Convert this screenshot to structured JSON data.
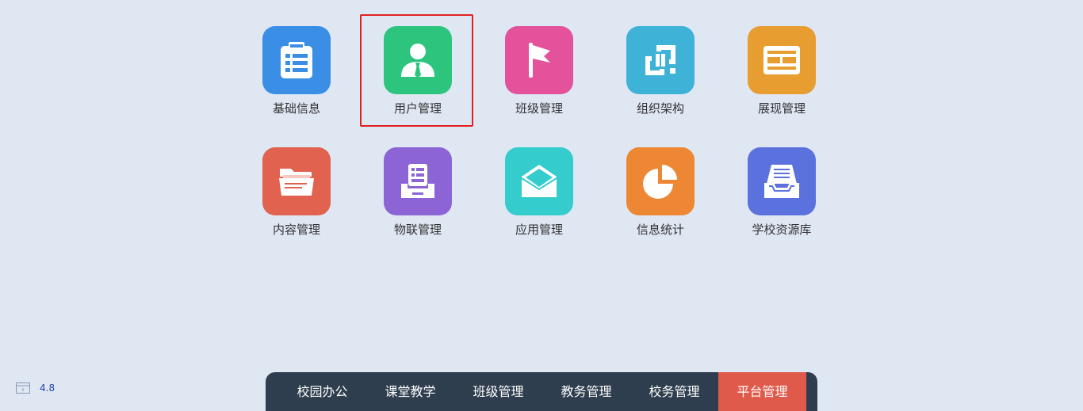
{
  "apps": [
    {
      "label": "基础信息",
      "icon": "clipboard-list-icon",
      "color": "#3a8ee6"
    },
    {
      "label": "用户管理",
      "icon": "user-tie-icon",
      "color": "#2dc47e"
    },
    {
      "label": "班级管理",
      "icon": "flag-icon",
      "color": "#e3529b"
    },
    {
      "label": "组织架构",
      "icon": "linked-squares-icon",
      "color": "#3fb2d8"
    },
    {
      "label": "展现管理",
      "icon": "layout-panel-icon",
      "color": "#e89d30"
    },
    {
      "label": "内容管理",
      "icon": "folder-icon",
      "color": "#e0624f"
    },
    {
      "label": "物联管理",
      "icon": "device-tray-icon",
      "color": "#8d64d6"
    },
    {
      "label": "应用管理",
      "icon": "open-envelope-icon",
      "color": "#35cccd"
    },
    {
      "label": "信息统计",
      "icon": "pie-chart-icon",
      "color": "#ee8734"
    },
    {
      "label": "学校资源库",
      "icon": "inbox-tray-icon",
      "color": "#5b71dd"
    }
  ],
  "highlight_color": "#e02020",
  "nav": {
    "items": [
      {
        "label": "校园办公"
      },
      {
        "label": "课堂教学"
      },
      {
        "label": "班级管理"
      },
      {
        "label": "教务管理"
      },
      {
        "label": "校务管理"
      },
      {
        "label": "平台管理"
      }
    ],
    "active_index": 5,
    "background": "#2f3e4e",
    "active_color": "#e05a4b"
  },
  "version": {
    "icon": "window-icon",
    "text": "4.8"
  }
}
